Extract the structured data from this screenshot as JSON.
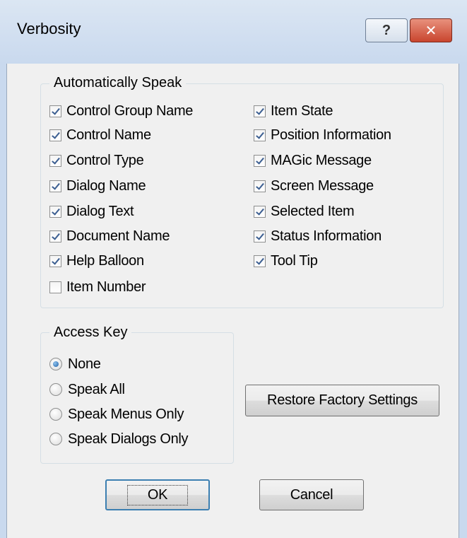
{
  "window": {
    "title": "Verbosity",
    "help_glyph": "?",
    "close_glyph": "✕"
  },
  "auto_speak": {
    "legend": "Automatically Speak",
    "left": [
      {
        "label": "Control Group Name",
        "checked": true
      },
      {
        "label": "Control Name",
        "checked": true
      },
      {
        "label": "Control Type",
        "checked": true
      },
      {
        "label": "Dialog Name",
        "checked": true
      },
      {
        "label": "Dialog Text",
        "checked": true
      },
      {
        "label": "Document Name",
        "checked": true
      },
      {
        "label": "Help Balloon",
        "checked": true
      },
      {
        "label": "Item Number",
        "checked": false
      }
    ],
    "right": [
      {
        "label": "Item State",
        "checked": true
      },
      {
        "label": "Position Information",
        "checked": true
      },
      {
        "label": "MAGic Message",
        "checked": true
      },
      {
        "label": "Screen Message",
        "checked": true
      },
      {
        "label": "Selected Item",
        "checked": true
      },
      {
        "label": "Status Information",
        "checked": true
      },
      {
        "label": "Tool Tip",
        "checked": true
      }
    ]
  },
  "access_key": {
    "legend": "Access Key",
    "options": [
      {
        "label": "None",
        "selected": true
      },
      {
        "label": "Speak All",
        "selected": false
      },
      {
        "label": "Speak Menus Only",
        "selected": false
      },
      {
        "label": "Speak Dialogs Only",
        "selected": false
      }
    ]
  },
  "buttons": {
    "restore": "Restore Factory Settings",
    "ok": "OK",
    "cancel": "Cancel"
  }
}
